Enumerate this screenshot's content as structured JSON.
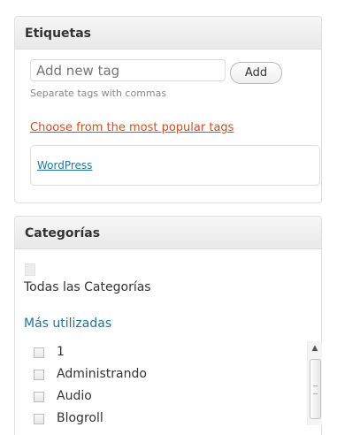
{
  "tags_box": {
    "title": "Etiquetas",
    "input_placeholder": "Add new tag",
    "add_button": "Add",
    "hint": "Separate tags with commas",
    "popular_link": "Choose from the most popular tags",
    "tag_cloud": [
      "WordPress"
    ]
  },
  "categories_box": {
    "title": "Categorías",
    "tab_all": "Todas las Categorías",
    "tab_most_used": "Más utilizadas",
    "items": [
      {
        "label": "1",
        "checked": false
      },
      {
        "label": "Administrando",
        "checked": false
      },
      {
        "label": "Audio",
        "checked": false
      },
      {
        "label": "Blogroll",
        "checked": false
      }
    ],
    "scroll_up_icon": "arrow-up-icon"
  },
  "colors": {
    "link_blue": "#21759b",
    "link_orange": "#d54e21"
  }
}
